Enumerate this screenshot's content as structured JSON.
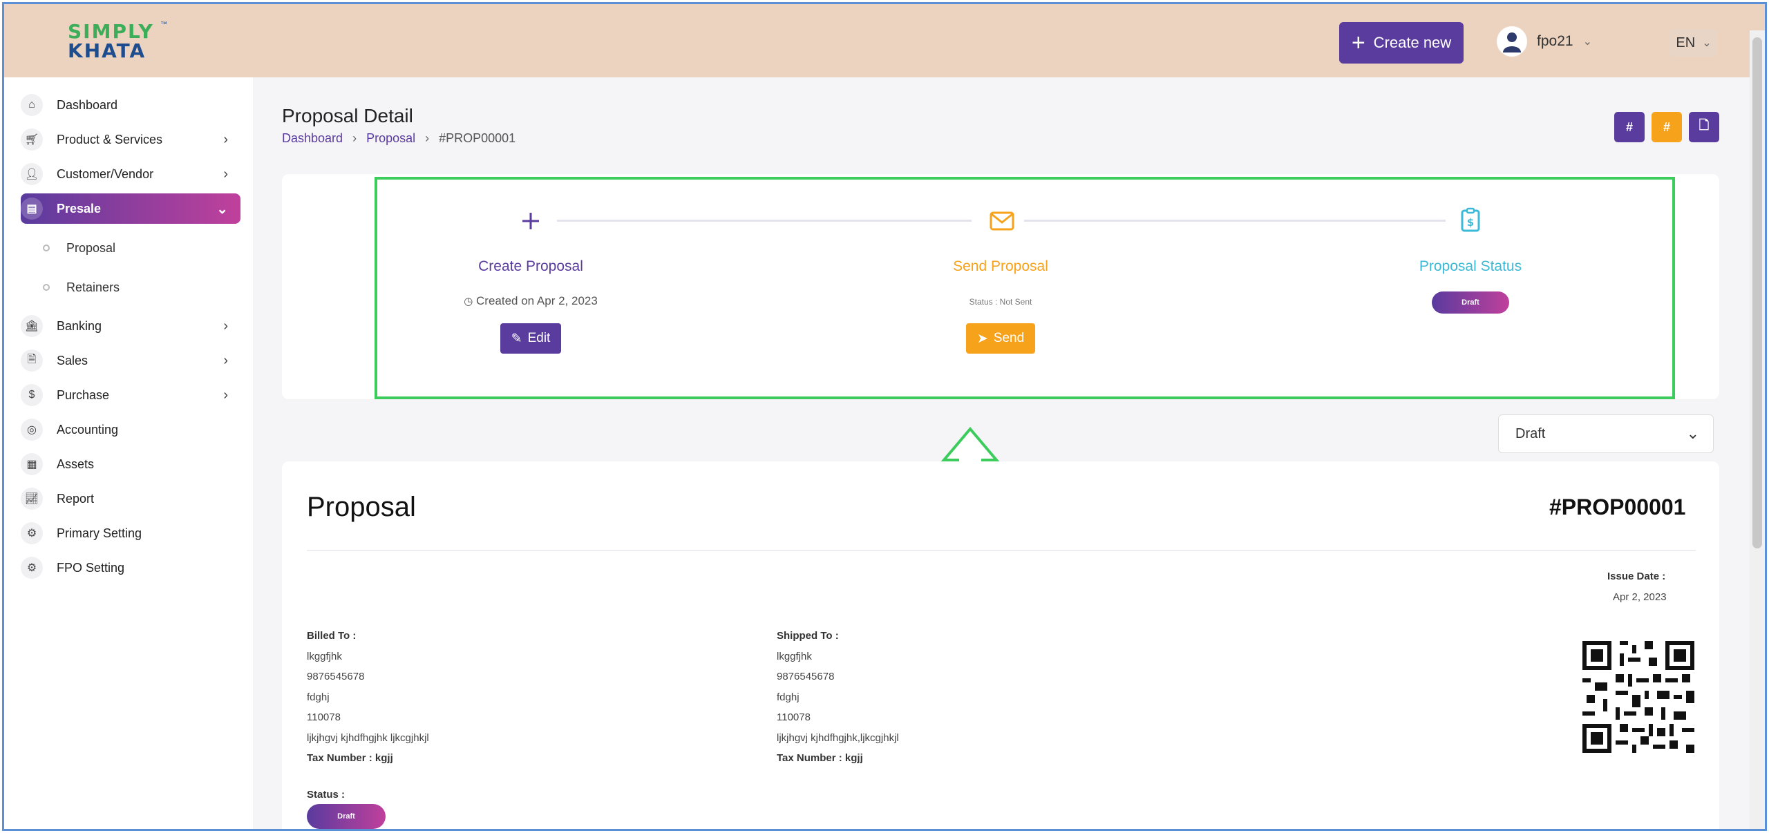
{
  "header": {
    "logo_line1": "SIMPLY",
    "logo_line2": "KHATA",
    "logo_tm": "™",
    "create_label": "Create new",
    "username": "fpo21",
    "language": "EN"
  },
  "sidebar": {
    "items": [
      {
        "label": "Dashboard"
      },
      {
        "label": "Product & Services"
      },
      {
        "label": "Customer/Vendor"
      },
      {
        "label": "Presale"
      },
      {
        "label": "Banking"
      },
      {
        "label": "Sales"
      },
      {
        "label": "Purchase"
      },
      {
        "label": "Accounting"
      },
      {
        "label": "Assets"
      },
      {
        "label": "Report"
      },
      {
        "label": "Primary Setting"
      },
      {
        "label": "FPO Setting"
      }
    ],
    "sub_items": [
      {
        "label": "Proposal"
      },
      {
        "label": "Retainers"
      }
    ]
  },
  "page": {
    "title": "Proposal Detail",
    "breadcrumb": [
      "Dashboard",
      "Proposal",
      "#PROP00001"
    ]
  },
  "steps": {
    "create": {
      "title": "Create Proposal",
      "sub": "Created on Apr 2, 2023",
      "button": "Edit"
    },
    "send": {
      "title": "Send Proposal",
      "sub": "Status : Not Sent",
      "button": "Send"
    },
    "status": {
      "title": "Proposal Status",
      "pill": "Draft"
    }
  },
  "status_select": {
    "value": "Draft"
  },
  "document": {
    "title": "Proposal",
    "number": "#PROP00001",
    "issue_label": "Issue Date :",
    "issue_date": "Apr 2, 2023",
    "billed": {
      "heading": "Billed To :",
      "name": "lkggfjhk",
      "phone": "9876545678",
      "line3": "fdghj",
      "pin": "110078",
      "line5": "ljkjhgvj kjhdfhgjhk ljkcgjhkjl",
      "tax": "Tax Number : kgjj"
    },
    "shipped": {
      "heading": "Shipped To :",
      "name": "lkggfjhk",
      "phone": "9876545678",
      "line3": "fdghj",
      "pin": "110078",
      "line5": "ljkjhgvj kjhdfhgjhk,ljkcgjhkjl",
      "tax": "Tax Number : kgjj"
    },
    "status_label": "Status :",
    "status_value": "Draft"
  },
  "colors": {
    "primary": "#5a3b9e",
    "orange": "#f7a21b",
    "teal": "#3bb9d6",
    "highlight": "#3ccc5c",
    "header_bg": "#ecd3bf"
  }
}
